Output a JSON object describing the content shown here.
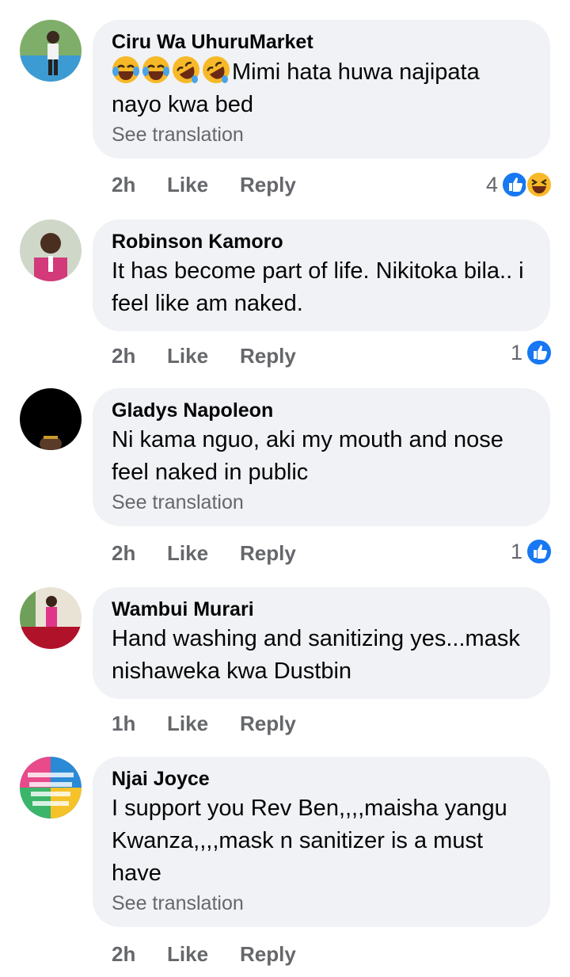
{
  "comments": [
    {
      "author": "Ciru Wa UhuruMarket",
      "emoji_prefix": [
        "face-tears-of-joy",
        "face-tears-of-joy",
        "rolling-laughing",
        "rolling-laughing"
      ],
      "text": "Mimi hata huwa najipata nayo kwa bed",
      "see_translation": "See translation",
      "time": "2h",
      "like_label": "Like",
      "reply_label": "Reply",
      "reaction_count": "4",
      "reaction_icons": [
        "like-icon",
        "haha-icon"
      ]
    },
    {
      "author": "Robinson Kamoro",
      "text": "It has become part of life. Nikitoka bila.. i feel like am naked.",
      "time": "2h",
      "like_label": "Like",
      "reply_label": "Reply",
      "reaction_count": "1",
      "reaction_icons": [
        "like-icon"
      ]
    },
    {
      "author": "Gladys Napoleon",
      "text": "Ni kama nguo, aki my mouth and nose feel naked in public",
      "see_translation": "See translation",
      "time": "2h",
      "like_label": "Like",
      "reply_label": "Reply",
      "reaction_count": "1",
      "reaction_icons": [
        "like-icon"
      ]
    },
    {
      "author": "Wambui Murari",
      "text": "Hand washing and sanitizing yes...mask nishaweka kwa Dustbin",
      "time": "1h",
      "like_label": "Like",
      "reply_label": "Reply"
    },
    {
      "author": "Njai Joyce",
      "text": "I support you Rev Ben,,,,maisha yangu Kwanza,,,,mask n sanitizer is a must have",
      "see_translation": "See translation",
      "time": "2h",
      "like_label": "Like",
      "reply_label": "Reply"
    }
  ],
  "colors": {
    "bubble": "#f0f2f5",
    "secondary_text": "#65676b",
    "like_blue": "#1877f2",
    "haha_yellow": "#f7b928"
  }
}
